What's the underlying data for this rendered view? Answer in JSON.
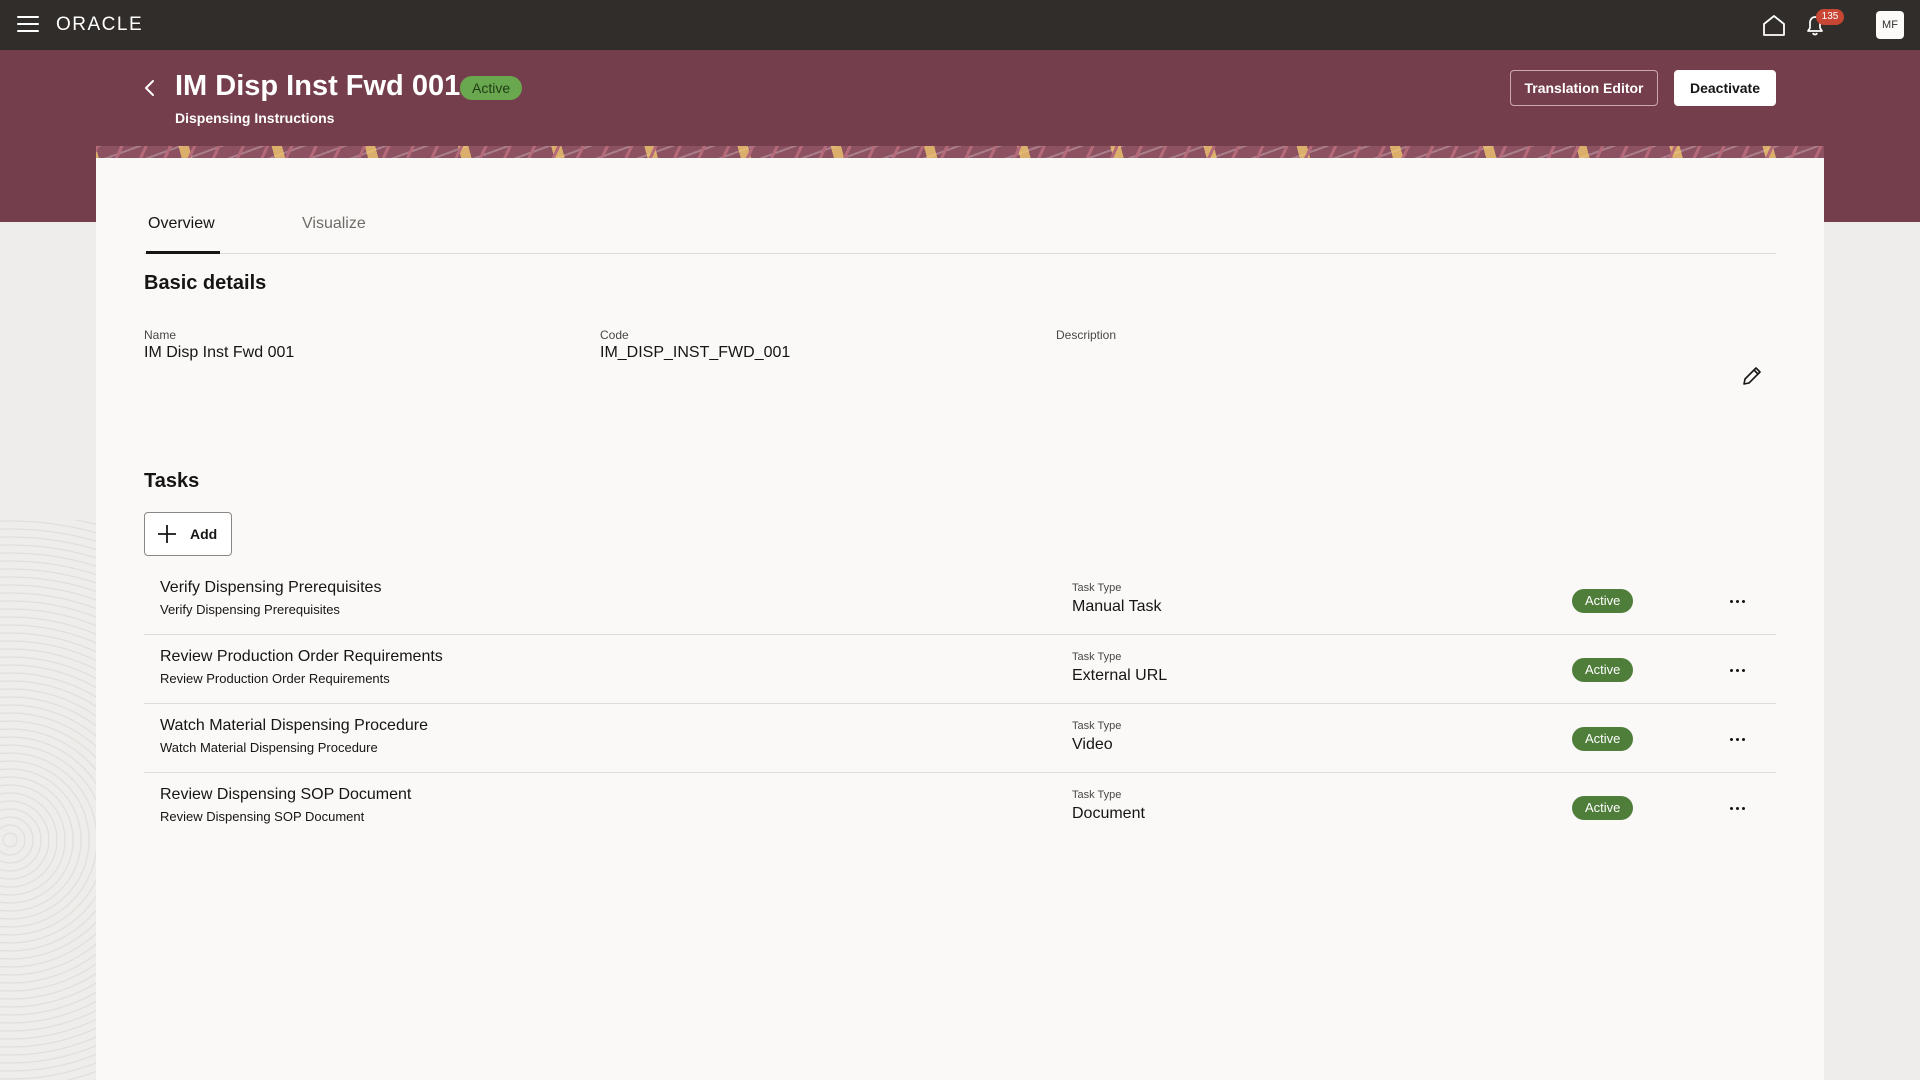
{
  "app": {
    "logo_text": "ORACLE"
  },
  "topbar": {
    "menu_icon": "hamburger-menu-icon",
    "home_icon": "home-icon",
    "notifications_icon": "bell-icon",
    "notification_count": "135",
    "avatar_initials": "MF"
  },
  "header": {
    "back_icon": "chevron-left-icon",
    "title": "IM Disp Inst Fwd 001",
    "status": "Active",
    "subtitle": "Dispensing Instructions",
    "translation_editor_label": "Translation Editor",
    "deactivate_label": "Deactivate"
  },
  "tabs": [
    {
      "label": "Overview",
      "selected": true
    },
    {
      "label": "Visualize",
      "selected": false
    }
  ],
  "basic_details": {
    "title": "Basic details",
    "name_label": "Name",
    "name_value": "IM Disp Inst Fwd 001",
    "code_label": "Code",
    "code_value": "IM_DISP_INST_FWD_001",
    "description_label": "Description",
    "description_value": "",
    "edit_icon": "pencil-icon"
  },
  "tasks": {
    "title": "Tasks",
    "add_label": "Add",
    "items": [
      {
        "name": "Verify Dispensing Prerequisites",
        "description": "Verify Dispensing Prerequisites",
        "type_label": "Task Type",
        "type": "Manual Task",
        "status": "Active"
      },
      {
        "name": "Review Production Order Requirements",
        "description": "Review Production Order Requirements",
        "type_label": "Task Type",
        "type": "External URL",
        "status": "Active"
      },
      {
        "name": "Watch Material Dispensing Procedure",
        "description": "Watch Material Dispensing Procedure",
        "type_label": "Task Type",
        "type": "Video",
        "status": "Active"
      },
      {
        "name": "Review Dispensing SOP Document",
        "description": "Review Dispensing SOP Document",
        "type_label": "Task Type",
        "type": "Document",
        "status": "Active"
      }
    ]
  },
  "colors": {
    "topbar": "#312d2a",
    "header_band": "#753e4c",
    "status_green": "#4f7d3a",
    "badge_red": "#c74634"
  }
}
